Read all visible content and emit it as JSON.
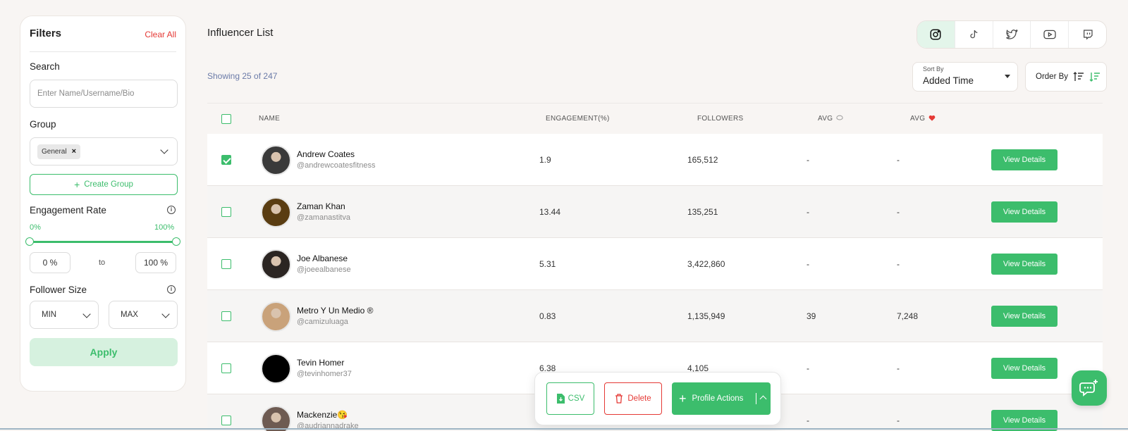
{
  "filters": {
    "title": "Filters",
    "clear_all": "Clear All",
    "search_label": "Search",
    "search_placeholder": "Enter Name/Username/Bio",
    "group_label": "Group",
    "group_chip": "General",
    "create_group": "Create Group",
    "engagement_label": "Engagement Rate",
    "engagement_min_pct": "0%",
    "engagement_max_pct": "100%",
    "range_min": "0 %",
    "range_to": "to",
    "range_max": "100 %",
    "follower_label": "Follower Size",
    "follower_min": "MIN",
    "follower_max": "MAX",
    "apply": "Apply"
  },
  "main": {
    "title": "Influencer List",
    "showing": "Showing 25 of 247",
    "sort_by_label": "Sort By",
    "sort_by_value": "Added Time",
    "order_by": "Order By",
    "platforms": [
      "instagram",
      "tiktok",
      "twitter",
      "youtube",
      "twitch"
    ],
    "active_platform": "instagram"
  },
  "table": {
    "columns": {
      "name": "NAME",
      "engagement": "ENGAGEMENT(%)",
      "followers": "FOLLOWERS",
      "avg_comments": "AVG",
      "avg_likes": "AVG"
    },
    "view_details": "View Details",
    "rows": [
      {
        "name": "Andrew Coates",
        "username": "@andrewcoatesfitness",
        "engagement": "1.9",
        "followers": "165,512",
        "avg_comments": "-",
        "avg_likes": "-",
        "checked": true,
        "avatar_color": "#3a3a3a"
      },
      {
        "name": "Zaman Khan",
        "username": "@zamanastitva",
        "engagement": "13.44",
        "followers": "135,251",
        "avg_comments": "-",
        "avg_likes": "-",
        "checked": false,
        "avatar_color": "#5a3d12"
      },
      {
        "name": "Joe Albanese",
        "username": "@joeealbanese",
        "engagement": "5.31",
        "followers": "3,422,860",
        "avg_comments": "-",
        "avg_likes": "-",
        "checked": false,
        "avatar_color": "#2b2522"
      },
      {
        "name": "Metro Y Un Medio ®",
        "username": "@camizuluaga",
        "engagement": "0.83",
        "followers": "1,135,949",
        "avg_comments": "39",
        "avg_likes": "7,248",
        "checked": false,
        "avatar_color": "#c9a27a"
      },
      {
        "name": "Tevin Homer",
        "username": "@tevinhomer37",
        "engagement": "6.38",
        "followers": "4,105",
        "avg_comments": "-",
        "avg_likes": "-",
        "checked": false,
        "avatar_color": "#000000"
      },
      {
        "name": "Mackenzie😘",
        "username": "@audriannadrake",
        "engagement": "",
        "followers": "",
        "avg_comments": "-",
        "avg_likes": "-",
        "checked": false,
        "avatar_color": "#6e5b52"
      }
    ]
  },
  "actions": {
    "csv": "CSV",
    "delete": "Delete",
    "profile_actions": "Profile Actions"
  },
  "colors": {
    "accent": "#3cbd6c",
    "danger": "#e53935",
    "background": "#f8f5f3"
  }
}
